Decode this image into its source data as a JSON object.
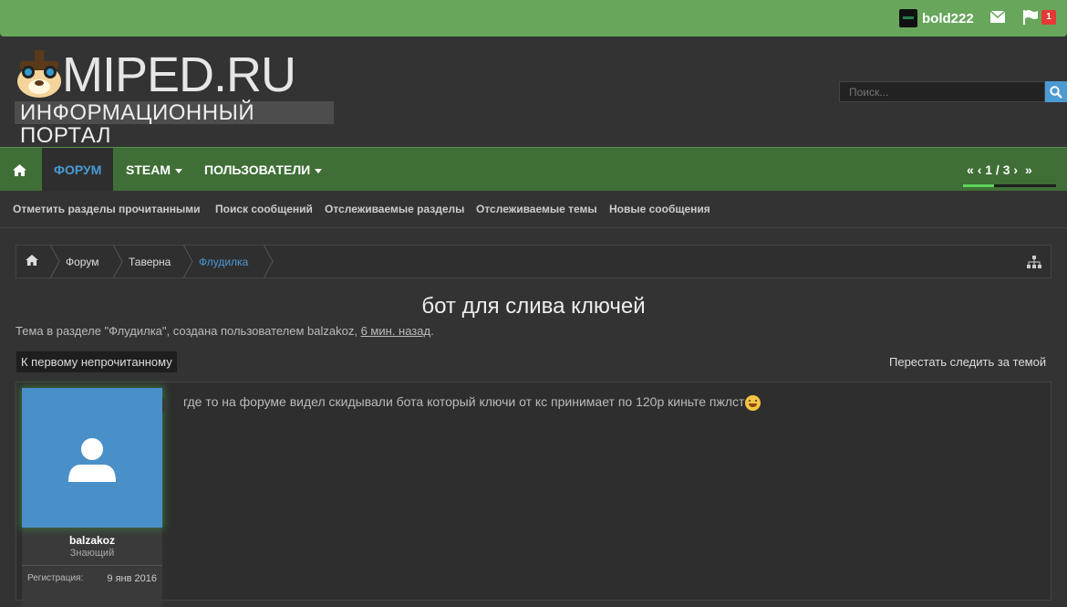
{
  "topbar": {
    "username": "bold222",
    "notifications": "1"
  },
  "logo": {
    "title": "MIPED.RU",
    "subtitle": "ИНФОРМАЦИОННЫЙ ПОРТАЛ"
  },
  "search": {
    "placeholder": "Поиск..."
  },
  "nav": {
    "tabs": [
      "ФОРУМ",
      "STEAM",
      "ПОЛЬЗОВАТЕЛИ"
    ],
    "pager": "1 / 3",
    "progress": 0.33
  },
  "subnav": [
    "Отметить разделы прочитанными",
    "Поиск сообщений",
    "Отслеживаемые разделы",
    "Отслеживаемые темы",
    "Новые сообщения"
  ],
  "breadcrumb": [
    "Форум",
    "Таверна",
    "Флудилка"
  ],
  "thread": {
    "title": "бот для слива ключей",
    "info_prefix": "Тема в разделе \"Флудилка\", создана пользователем balzakoz,",
    "info_time": "6 мин. назад",
    "info_suffix": ".",
    "first_unread": "К первому непрочитанному",
    "unwatch": "Перестать следить за темой"
  },
  "post": {
    "author": "balzakoz",
    "role": "Знающий",
    "reg_label": "Регистрация:",
    "reg_date": "9 янв 2016",
    "message": "где то на форуме видел скидывали бота который ключи от кс принимает по 120р киньте пжлст"
  }
}
